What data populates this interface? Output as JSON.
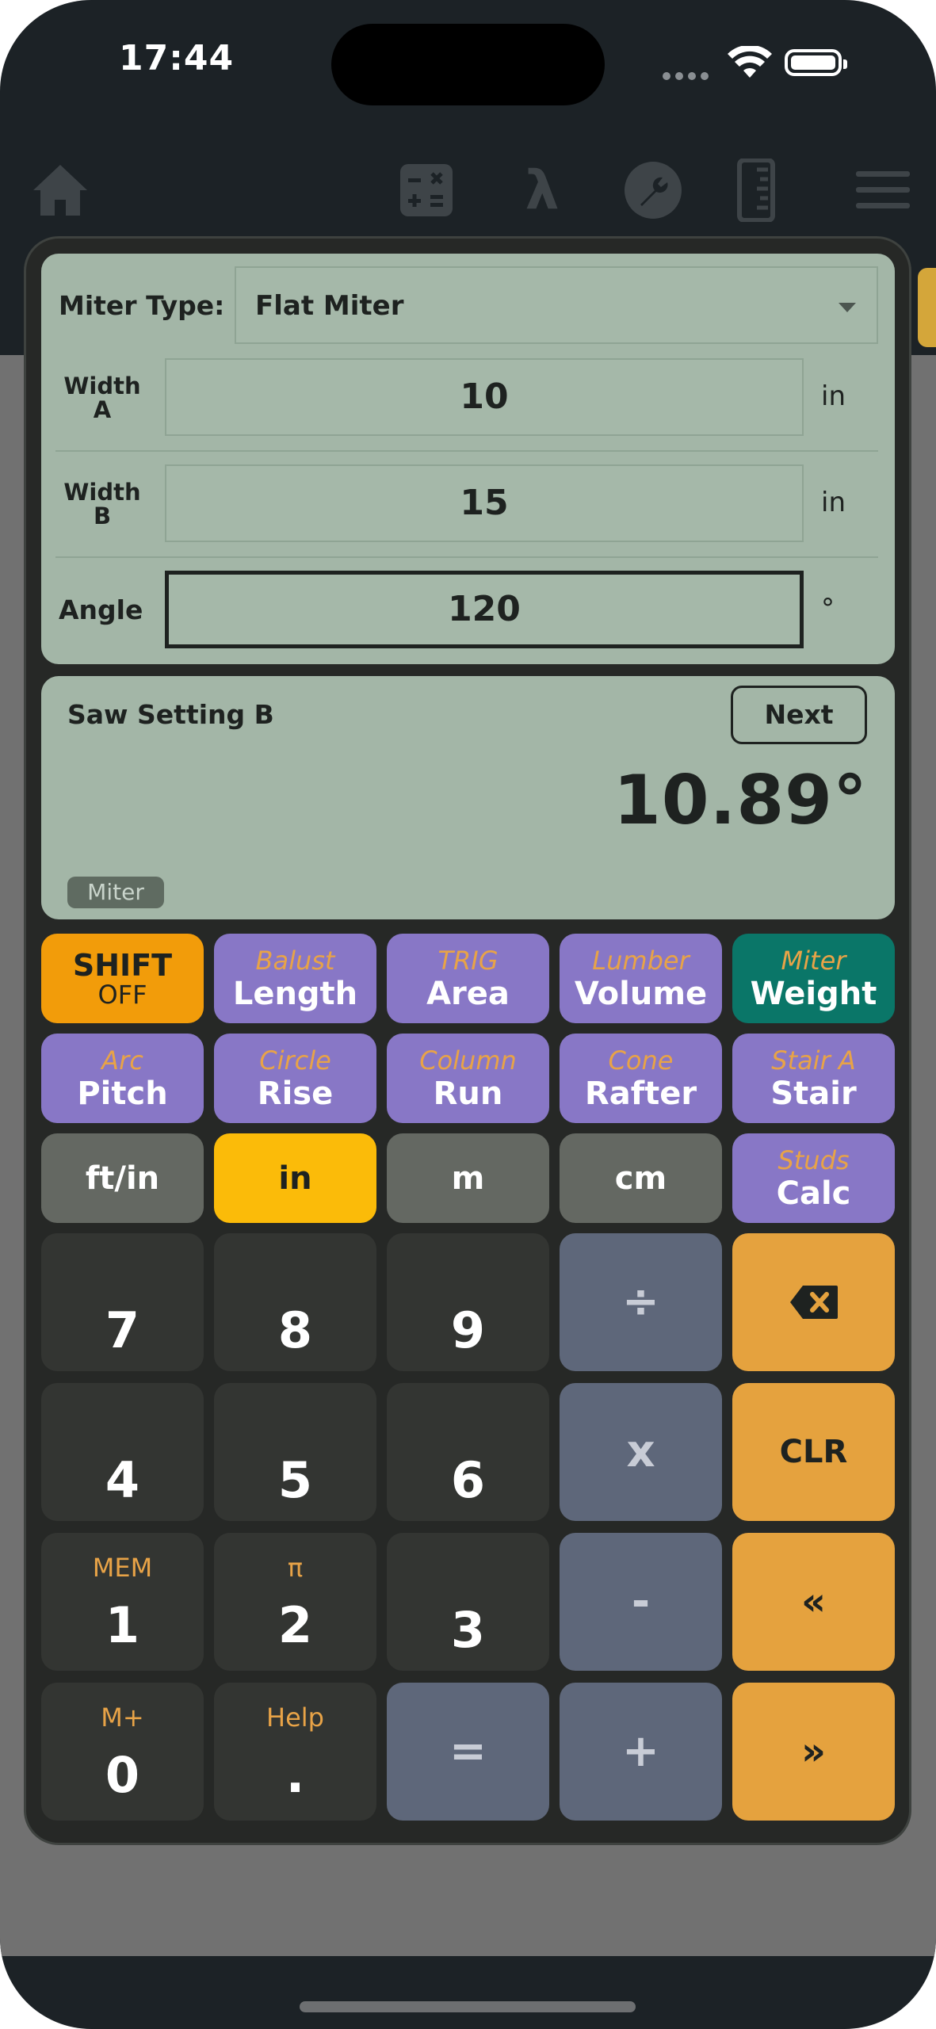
{
  "status_bar": {
    "time": "17:44"
  },
  "nav": {
    "icons": [
      "home-icon",
      "calculator-icon",
      "lambda-icon",
      "wrench-icon",
      "ruler-icon",
      "menu-icon"
    ],
    "lambda_glyph": "λ"
  },
  "inputs": {
    "miter_type_label": "Miter Type:",
    "miter_type_value": "Flat Miter",
    "width_a_label_1": "Width",
    "width_a_label_2": "A",
    "width_a_value": "10",
    "width_a_unit": "in",
    "width_b_label_1": "Width",
    "width_b_label_2": "B",
    "width_b_value": "15",
    "width_b_unit": "in",
    "angle_label": "Angle",
    "angle_value": "120",
    "angle_unit": "°"
  },
  "result": {
    "title": "Saw Setting B",
    "next_label": "Next",
    "value": "10.89°",
    "chip": "Miter"
  },
  "keypad": {
    "row1": [
      {
        "main": "SHIFT",
        "sub": "OFF"
      },
      {
        "sub": "Balust",
        "main": "Length"
      },
      {
        "sub": "TRIG",
        "main": "Area"
      },
      {
        "sub": "Lumber",
        "main": "Volume"
      },
      {
        "sub": "Miter",
        "main": "Weight"
      }
    ],
    "row2": [
      {
        "sub": "Arc",
        "main": "Pitch"
      },
      {
        "sub": "Circle",
        "main": "Rise"
      },
      {
        "sub": "Column",
        "main": "Run"
      },
      {
        "sub": "Cone",
        "main": "Rafter"
      },
      {
        "sub": "Stair A",
        "main": "Stair"
      }
    ],
    "row3": [
      {
        "main": "ft/in"
      },
      {
        "main": "in"
      },
      {
        "main": "m"
      },
      {
        "main": "cm"
      },
      {
        "sub": "Studs",
        "main": "Calc"
      }
    ],
    "digits": {
      "k7": "7",
      "k8": "8",
      "k9": "9",
      "k4": "4",
      "k5": "5",
      "k6": "6",
      "k1": "1",
      "k2": "2",
      "k3": "3",
      "k0": "0",
      "kdot": "."
    },
    "digit_tops": {
      "k1": "MEM",
      "k2": "π",
      "k0": "M+",
      "kdot": "Help"
    },
    "ops": {
      "divide": "÷",
      "multiply": "x",
      "minus": "-",
      "plus": "+",
      "equals": "="
    },
    "actions": {
      "clear": "CLR",
      "prev": "«",
      "next": "»"
    }
  },
  "colors": {
    "panel": "#a3b6a7",
    "purple_key": "#8877c6",
    "teal_key": "#0a7668",
    "shift_key": "#f29c0a",
    "active_unit": "#fbbb09",
    "action_key": "#e5a23e",
    "operator_key": "#5e677a",
    "number_key": "#333532"
  }
}
